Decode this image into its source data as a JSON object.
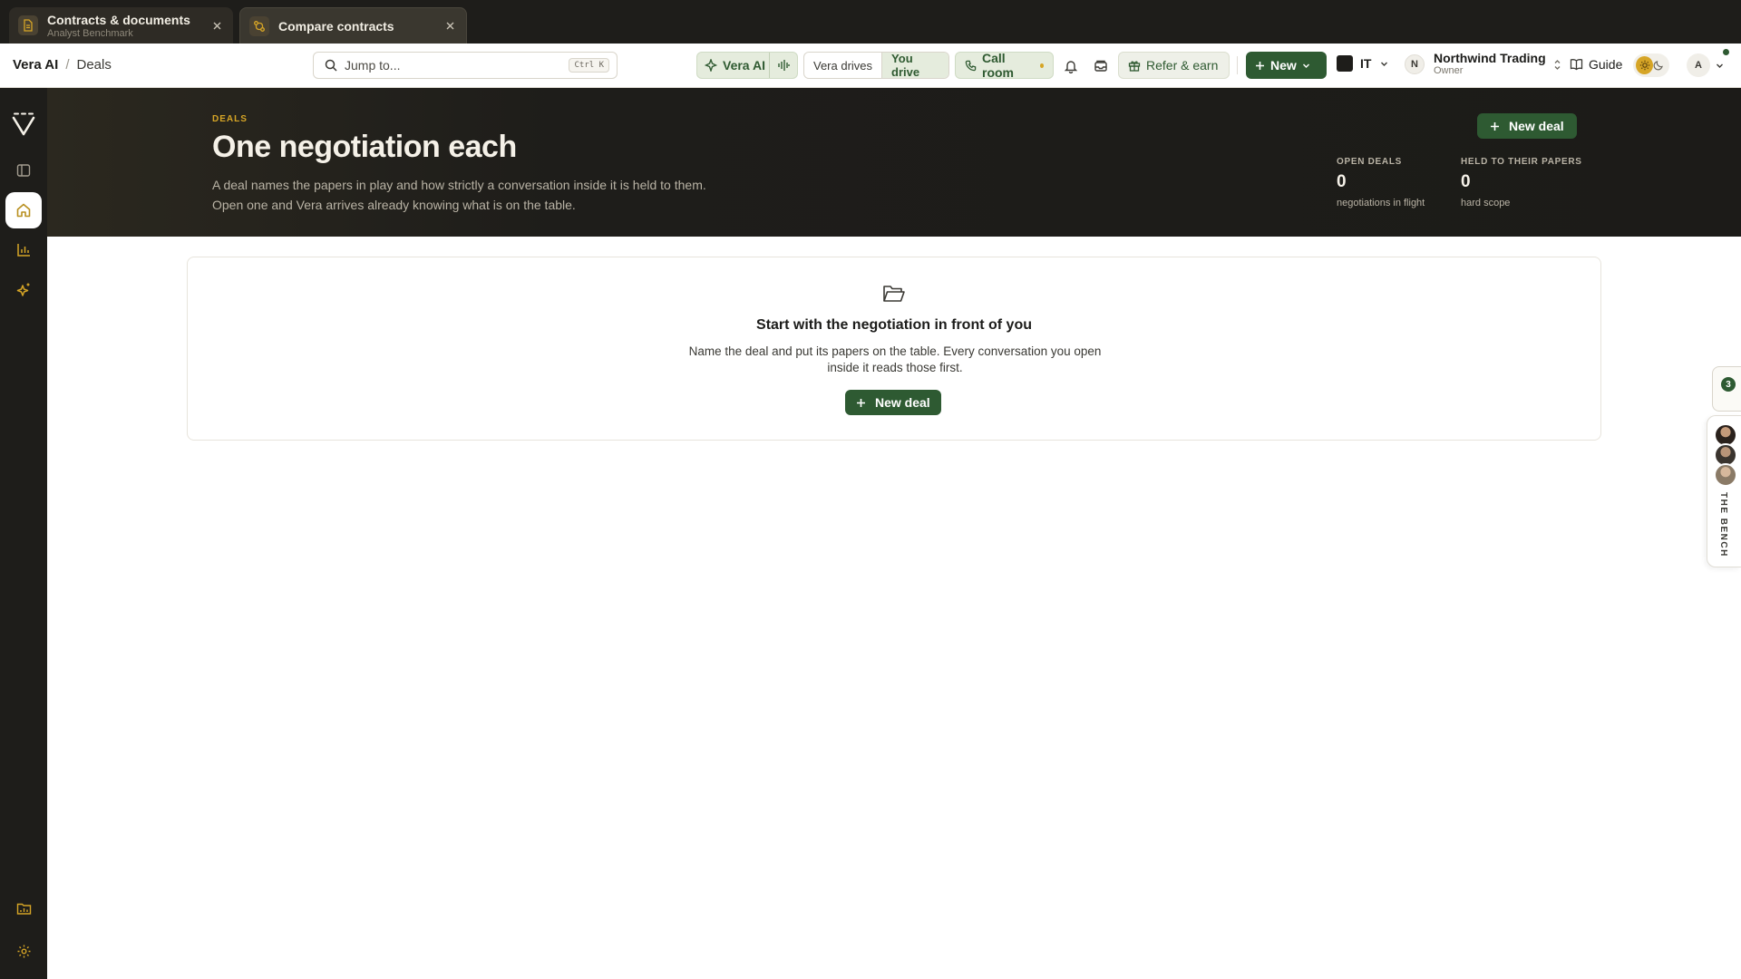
{
  "tabs": [
    {
      "title": "Contracts & documents",
      "subtitle": "Analyst Benchmark"
    },
    {
      "title": "Compare contracts"
    }
  ],
  "breadcrumb": {
    "root": "Vera AI",
    "current": "Deals"
  },
  "search": {
    "placeholder": "Jump to...",
    "shortcut": "Ctrl K"
  },
  "toolbar": {
    "vera_ai_label": "Vera AI",
    "mode_options": [
      "Vera drives",
      "You drive"
    ],
    "mode_selected": "You drive",
    "call_room_label": "Call room",
    "refer_label": "Refer & earn",
    "new_label": "New",
    "language": "IT",
    "guide_label": "Guide"
  },
  "org": {
    "initial": "N",
    "name": "Northwind Trading",
    "role": "Owner"
  },
  "user": {
    "initial": "A"
  },
  "hero": {
    "eyebrow": "DEALS",
    "title": "One negotiation each",
    "description_line1": "A deal names the papers in play and how strictly a conversation inside it is held to them.",
    "description_line2": "Open one and Vera arrives already knowing what is on the table.",
    "new_deal_label": "New deal",
    "stats": [
      {
        "label": "OPEN DEALS",
        "value": "0",
        "sub": "negotiations in flight"
      },
      {
        "label": "HELD TO THEIR PAPERS",
        "value": "0",
        "sub": "hard scope"
      }
    ]
  },
  "empty_state": {
    "title": "Start with the negotiation in front of you",
    "description": "Name the deal and put its papers on the table. Every conversation you open inside it reads those first.",
    "button_label": "New deal"
  },
  "bench": {
    "count": "3",
    "label": "THE BENCH"
  },
  "colors": {
    "accent_green": "#2e5a32",
    "accent_gold": "#d6a526",
    "dark_bg": "#1e1d1a"
  }
}
